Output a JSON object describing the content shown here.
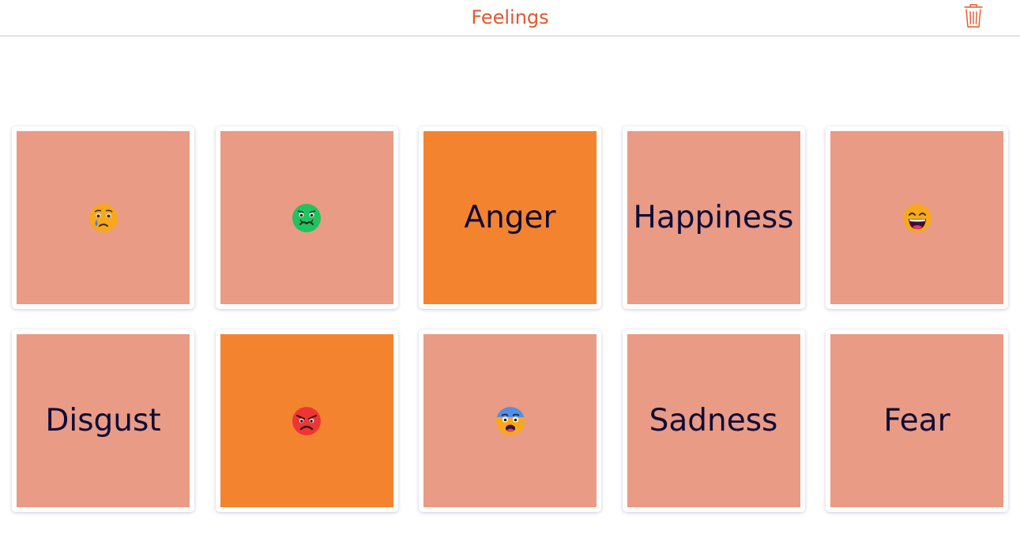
{
  "header": {
    "title": "Feelings",
    "trash_icon": "trash-icon"
  },
  "colors": {
    "accent": "#e4572e",
    "card_face": "#e99b85",
    "card_selected": "#f48330",
    "text": "#0e0b38"
  },
  "cards": [
    {
      "kind": "emoji",
      "label": "",
      "icon": "crying-face-icon",
      "selected": false
    },
    {
      "kind": "emoji",
      "label": "",
      "icon": "nauseated-face-icon",
      "selected": false
    },
    {
      "kind": "word",
      "label": "Anger",
      "icon": "",
      "selected": true
    },
    {
      "kind": "word",
      "label": "Happiness",
      "icon": "",
      "selected": false
    },
    {
      "kind": "emoji",
      "label": "",
      "icon": "grinning-face-icon",
      "selected": false
    },
    {
      "kind": "word",
      "label": "Disgust",
      "icon": "",
      "selected": false
    },
    {
      "kind": "emoji",
      "label": "",
      "icon": "angry-face-icon",
      "selected": true
    },
    {
      "kind": "emoji",
      "label": "",
      "icon": "fearful-face-icon",
      "selected": false
    },
    {
      "kind": "word",
      "label": "Sadness",
      "icon": "",
      "selected": false
    },
    {
      "kind": "word",
      "label": "Fear",
      "icon": "",
      "selected": false
    }
  ]
}
